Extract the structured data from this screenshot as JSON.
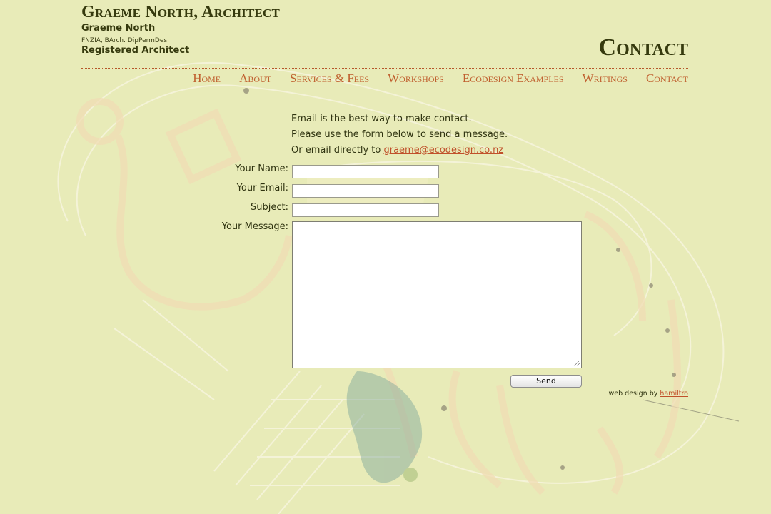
{
  "header": {
    "site_title": "Graeme North, Architect",
    "owner_name": "Graeme North",
    "qualifications": "FNZIA, BArch. DipPermDes",
    "registration": "Registered Architect",
    "page_heading": "Contact"
  },
  "nav": {
    "items": [
      {
        "label": "Home"
      },
      {
        "label": "About"
      },
      {
        "label": "Services & Fees"
      },
      {
        "label": "Workshops"
      },
      {
        "label": "Ecodesign Examples"
      },
      {
        "label": "Writings"
      },
      {
        "label": "Contact"
      }
    ]
  },
  "intro": {
    "line1": "Email is the best way to make contact.",
    "line2": "Please use the form below to send a message.",
    "line3_prefix": "Or email directly to ",
    "email_link": "graeme@ecodesign.co.nz"
  },
  "form": {
    "name_label": "Your Name:",
    "name_value": "",
    "email_label": "Your Email:",
    "email_value": "",
    "subject_label": "Subject:",
    "subject_value": "",
    "message_label": "Your Message:",
    "message_value": "",
    "send_label": "Send"
  },
  "footer": {
    "credit_prefix": "web design by ",
    "credit_link": "hamiltro"
  },
  "colors": {
    "background": "#e8ebb8",
    "title_text": "#363a0e",
    "nav_link": "#c0602f",
    "link": "#c0502a",
    "divider": "#b5582a"
  }
}
